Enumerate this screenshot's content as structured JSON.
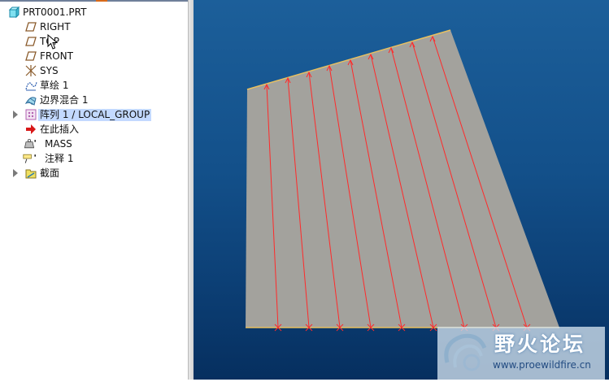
{
  "model_tree": {
    "items": [
      {
        "label": "PRT0001.PRT",
        "icon": "part-icon",
        "expandable": false,
        "selected": false
      },
      {
        "label": "RIGHT",
        "icon": "datum-plane-icon",
        "expandable": false,
        "selected": false
      },
      {
        "label": "TOP",
        "icon": "datum-plane-icon",
        "expandable": false,
        "selected": false
      },
      {
        "label": "FRONT",
        "icon": "datum-plane-icon",
        "expandable": false,
        "selected": false
      },
      {
        "label": "SYS",
        "icon": "coordinate-system-icon",
        "expandable": false,
        "selected": false
      },
      {
        "label": "草绘 1",
        "icon": "sketch-icon",
        "expandable": false,
        "selected": false
      },
      {
        "label": "边界混合 1",
        "icon": "boundary-blend-icon",
        "expandable": false,
        "selected": false
      },
      {
        "label": "阵列 1 / LOCAL_GROUP",
        "icon": "pattern-icon",
        "expandable": true,
        "selected": true
      },
      {
        "label": "在此插入",
        "icon": "insert-here-arrow-icon",
        "expandable": false,
        "selected": false
      },
      {
        "label": "MASS",
        "icon": "mass-properties-icon",
        "expandable": false,
        "selected": false
      },
      {
        "label": "注释 1",
        "icon": "annotation-icon",
        "expandable": false,
        "selected": false
      },
      {
        "label": "截面",
        "icon": "cross-section-folder-icon",
        "expandable": true,
        "selected": false
      }
    ]
  },
  "viewport": {
    "surface_color": "#a3a29d",
    "curve_color": "#ff2a2a",
    "edge_color": "#e8c060",
    "background_top": "#1c5f9a",
    "background_bottom": "#062f5f"
  },
  "watermark": {
    "title": "野火论坛",
    "url": "www.proewildfire.cn",
    "icon": "wildfire-logo-icon"
  }
}
